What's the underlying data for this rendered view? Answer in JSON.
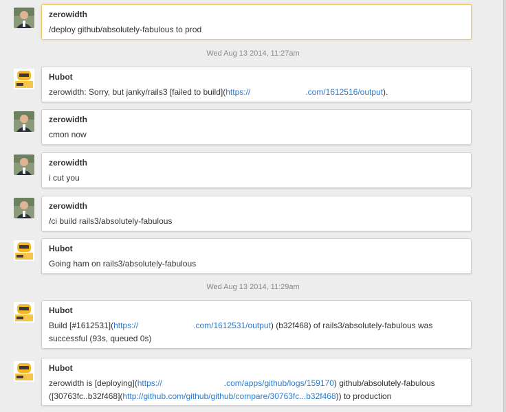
{
  "messages": [
    {
      "author": "zerowidth",
      "avatar": "user-photo",
      "text": "/deploy github/absolutely-fabulous to prod"
    },
    {
      "author": "Hubot",
      "avatar": "hubot-robot",
      "pre": "zerowidth: Sorry, but janky/rails3 [failed to build](",
      "link_a": "https://",
      "link_b": ".com/1612516/output",
      "post": ")."
    },
    {
      "author": "zerowidth",
      "avatar": "user-photo",
      "text": "cmon now"
    },
    {
      "author": "zerowidth",
      "avatar": "user-photo",
      "text": "i cut you"
    },
    {
      "author": "zerowidth",
      "avatar": "user-photo",
      "text": "/ci build rails3/absolutely-fabulous"
    },
    {
      "author": "Hubot",
      "avatar": "hubot-robot",
      "text": "Going ham on rails3/absolutely-fabulous"
    },
    {
      "author": "Hubot",
      "avatar": "hubot-robot",
      "pre": "Build [#1612531](",
      "link_a": "https://",
      "link_b": ".com/1612531/output",
      "post": ") (b32f468) of rails3/absolutely-fabulous was",
      "line2": "successful (93s, queued 0s)"
    },
    {
      "author": "Hubot",
      "avatar": "hubot-robot",
      "pre": "zerowidth is [deploying](",
      "link_a": "https://",
      "link_b": ".com/apps/github/logs/159170",
      "post": ") github/absolutely-fabulous",
      "line2_pre": "([30763fc..b32f468](",
      "line2_link": "http://github.com/github/github/compare/30763fc...b32f468",
      "line2_post": ")) to production"
    }
  ],
  "timestamps": [
    "Wed Aug 13 2014, 11:27am",
    "Wed Aug 13 2014, 11:29am"
  ],
  "colors": {
    "link": "#2a7bd1",
    "highlight_border": "#f0c35c",
    "background": "#ededed"
  }
}
